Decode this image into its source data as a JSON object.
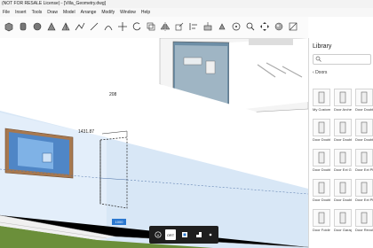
{
  "window": {
    "title": "(NOT FOR RESALE License) - [Villa_Geometry.dwg]"
  },
  "menu": [
    "File",
    "Insert",
    "Tools",
    "Draw",
    "Model",
    "Arrange",
    "Modify",
    "Window",
    "Help"
  ],
  "toolbar": {
    "icons": [
      "box-icon",
      "cylinder-icon",
      "sphere-icon",
      "cone-icon",
      "pyramid-icon",
      "polyline-icon",
      "line-icon",
      "arc-icon",
      "move-icon",
      "rotate-icon",
      "copy-icon",
      "mirror-icon",
      "scale-icon",
      "align-icon",
      "extrude-icon",
      "push-pull-icon",
      "orbit-icon",
      "zoom-icon",
      "pan-icon",
      "render-icon",
      "section-icon",
      "measure-icon"
    ]
  },
  "viewport": {
    "dimensions": {
      "height": "208",
      "horizontal": "1431.87"
    },
    "dimension_input": "1000"
  },
  "library": {
    "title": "Library",
    "search_placeholder": "",
    "breadcrumb": "Doors",
    "items": [
      "My Custom",
      "Door Arched Si...",
      "Door Double StandardDoor...",
      "Door Double SingleDoor...",
      "Door Double SingleDoor...",
      "Door Double SingleDoor...",
      "Door Double SingleDoor...",
      "Door Ext Glass",
      "Door Ext Plain",
      "Door Double SingleDoor...",
      "Door Double SingleDoor...",
      "Door Ext Plain",
      "Door Folding",
      "Door Garage",
      "Door Revolving"
    ]
  },
  "floating_toolbar": {
    "items": [
      "info-icon",
      "ortho-label",
      "snap-icon",
      "grid-icon",
      "dot-icon"
    ],
    "ortho_label": "ORT"
  }
}
